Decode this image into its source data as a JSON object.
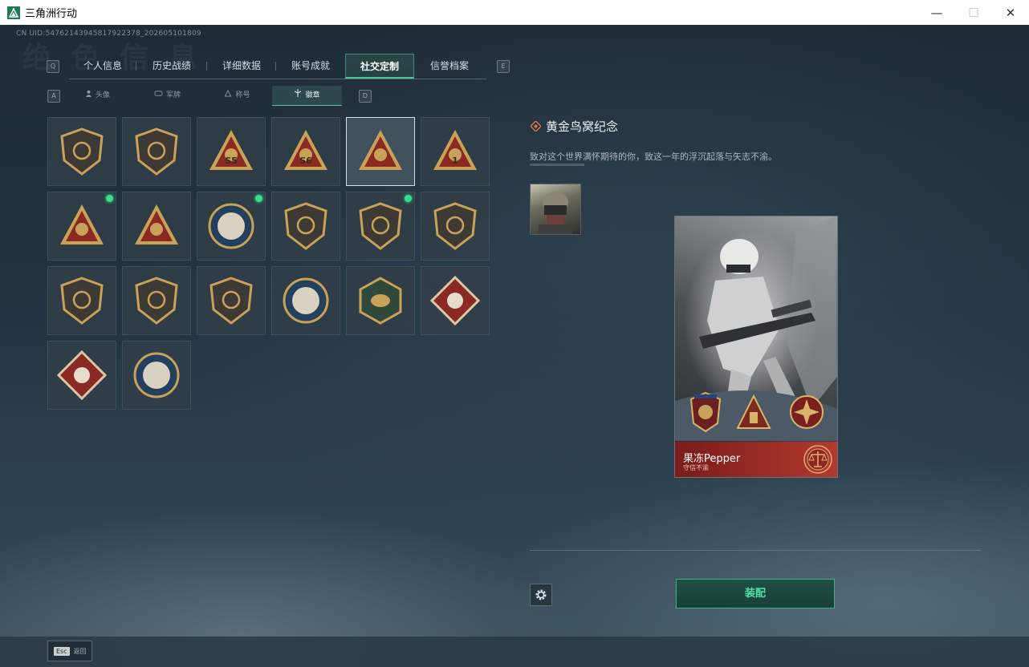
{
  "window": {
    "title": "三角洲行动",
    "minimize_glyph": "—",
    "maximize_glyph": "☐",
    "close_glyph": "✕",
    "app_icon": "delta-logo-icon"
  },
  "uid_text": "CN UID:5476214394581792237​8_202605101809",
  "tabs": {
    "left_key": "Q",
    "right_key": "E",
    "items": [
      {
        "label": "个人信息",
        "width": 84
      },
      {
        "label": "历史战绩",
        "width": 88
      },
      {
        "label": "详细数据",
        "width": 86
      },
      {
        "label": "账号成就",
        "width": 86
      },
      {
        "label": "社交定制",
        "width": 86
      },
      {
        "label": "信誉档案",
        "width": 88
      }
    ],
    "active_index": 4
  },
  "subtabs": {
    "left_key": "A",
    "right_key": "D",
    "items": [
      {
        "label": "头像",
        "icon": "person-icon"
      },
      {
        "label": "军牌",
        "icon": "dogtag-icon"
      },
      {
        "label": "称号",
        "icon": "title-icon"
      },
      {
        "label": "徽章",
        "icon": "badge-icon"
      }
    ],
    "active_index": 3
  },
  "badges": [
    {
      "name": "delta-logo-badge",
      "shape": "shield",
      "new": false
    },
    {
      "name": "helicopter-badge",
      "shape": "shield",
      "new": false
    },
    {
      "name": "s5-badge",
      "shape": "triangle",
      "text": "S5",
      "new": false
    },
    {
      "name": "s6-badge",
      "shape": "triangle",
      "text": "S6",
      "new": false
    },
    {
      "name": "golden-nest-badge",
      "shape": "triangle",
      "new": false,
      "selected": true
    },
    {
      "name": "number-one-badge",
      "shape": "triangle",
      "text": "1",
      "new": false
    },
    {
      "name": "usb-badge",
      "shape": "triangle",
      "new": true
    },
    {
      "name": "tactical-triangle-badge",
      "shape": "triangle",
      "new": false
    },
    {
      "name": "compass-star-badge",
      "shape": "round",
      "new": true
    },
    {
      "name": "shield-emblem-badge",
      "shape": "shield",
      "new": false
    },
    {
      "name": "stars-shield-badge",
      "shape": "shield",
      "new": true
    },
    {
      "name": "gem-shield-badge",
      "shape": "shield",
      "new": false
    },
    {
      "name": "green-rifle-badge",
      "shape": "shield",
      "new": false
    },
    {
      "name": "rifle-shield-badge",
      "shape": "shield",
      "new": false
    },
    {
      "name": "blue-crossed-rifles-badge",
      "shape": "shield",
      "new": false
    },
    {
      "name": "eagle-badge",
      "shape": "round",
      "new": false
    },
    {
      "name": "wasp-badge",
      "shape": "hex",
      "new": false
    },
    {
      "name": "red-dragon-badge",
      "shape": "diamond",
      "new": false
    },
    {
      "name": "runner-badge",
      "shape": "diamond",
      "new": false
    },
    {
      "name": "lynx-badge",
      "shape": "round",
      "new": false
    }
  ],
  "detail": {
    "title": "黄金鸟窝纪念",
    "description": "致对这个世界满怀期待的你，致这一年的浮沉起落与矢志不渝。",
    "player_name": "果冻Pepper",
    "player_subtitle": "守信不渝"
  },
  "equip_label": "装配",
  "esc": {
    "key": "Esc",
    "label": "返回"
  },
  "colors": {
    "accent_green": "#4fe0a8",
    "new_dot": "#36e08c",
    "badge_gold": "#c9a25a",
    "badge_red": "#8a2a22",
    "card_red": "#9e2b25"
  }
}
